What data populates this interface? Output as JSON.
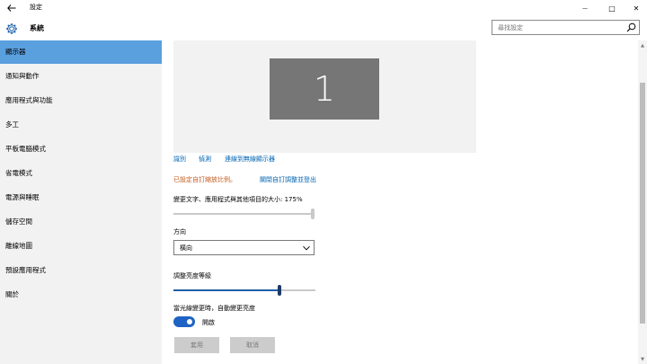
{
  "window": {
    "title": "設定",
    "back_icon": "back-arrow-icon",
    "minimize_glyph": "—",
    "maximize_glyph": "□",
    "close_glyph": "✕"
  },
  "header": {
    "icon": "gear-icon",
    "title": "系統"
  },
  "search": {
    "placeholder": "尋找設定",
    "icon": "search-icon"
  },
  "sidebar": {
    "selected_color": "#5a9fde",
    "items": [
      {
        "label": "顯示器",
        "selected": true
      },
      {
        "label": "通知與動作",
        "selected": false
      },
      {
        "label": "應用程式與功能",
        "selected": false
      },
      {
        "label": "多工",
        "selected": false
      },
      {
        "label": "平板電腦模式",
        "selected": false
      },
      {
        "label": "省電模式",
        "selected": false
      },
      {
        "label": "電源與睡眠",
        "selected": false
      },
      {
        "label": "儲存空間",
        "selected": false
      },
      {
        "label": "離線地圖",
        "selected": false
      },
      {
        "label": "預設應用程式",
        "selected": false
      },
      {
        "label": "關於",
        "selected": false
      }
    ]
  },
  "display": {
    "monitor_number": "1",
    "links": {
      "identify": "識別",
      "detect": "偵測",
      "connect_wireless": "連線到無線顯示器"
    },
    "custom_scale_notice": "已設定自訂縮放比例。",
    "disable_custom_scale_link": "關閉自訂調整並登出",
    "scale_label": "變更文字、應用程式與其他項目的大小: 175%",
    "scale_level": 1.0,
    "orientation_label": "方向",
    "orientation_value": "橫向",
    "brightness_label": "調整亮度等級",
    "brightness_level": 0.75,
    "auto_brightness_label": "當光線變更時，自動變更亮度",
    "auto_brightness_toggle": true,
    "auto_brightness_state": "開啟",
    "apply_button": "套用",
    "cancel_button": "取消",
    "accent_color": "#1e63c4",
    "warning_color": "#c45a1e",
    "link_color": "#0063b1"
  }
}
